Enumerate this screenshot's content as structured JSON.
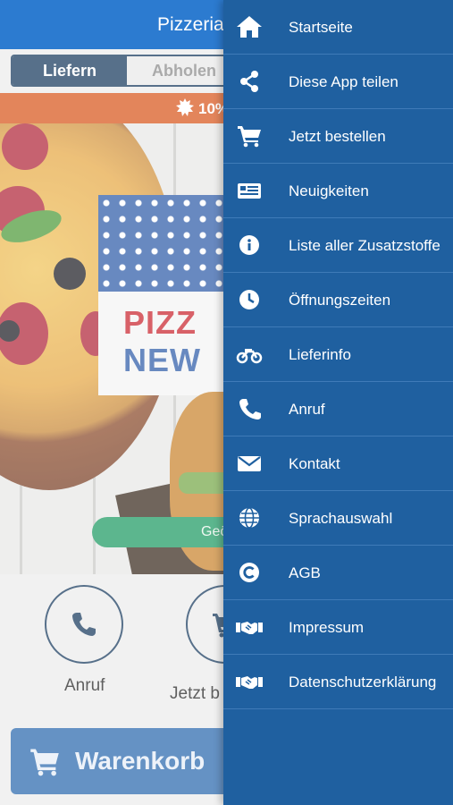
{
  "app": {
    "title": "Pizzeria",
    "order_mode": {
      "options": [
        "Liefern",
        "Abholen"
      ],
      "selected": "Liefern"
    },
    "promo_text": "10%",
    "hero": {
      "sign_line1": "PIZZ",
      "sign_line2": "NEW",
      "open_status": "Geö"
    },
    "quick_actions": [
      {
        "label": "Anruf",
        "icon": "phone-icon"
      },
      {
        "label": "Jetzt b",
        "icon": "cart-icon"
      }
    ],
    "cart_button": {
      "label": "Warenkorb",
      "icon": "cart-icon"
    }
  },
  "drawer": {
    "items": [
      {
        "label": "Startseite",
        "icon": "home-icon"
      },
      {
        "label": "Diese App teilen",
        "icon": "share-icon"
      },
      {
        "label": "Jetzt bestellen",
        "icon": "cart-icon"
      },
      {
        "label": "Neuigkeiten",
        "icon": "newspaper-icon"
      },
      {
        "label": "Liste aller Zusatzstoffe",
        "icon": "info-icon"
      },
      {
        "label": "Öffnungszeiten",
        "icon": "clock-icon"
      },
      {
        "label": "Lieferinfo",
        "icon": "motorcycle-icon"
      },
      {
        "label": "Anruf",
        "icon": "phone-icon"
      },
      {
        "label": "Kontakt",
        "icon": "envelope-icon"
      },
      {
        "label": "Sprachauswahl",
        "icon": "globe-icon"
      },
      {
        "label": "AGB",
        "icon": "copyright-icon"
      },
      {
        "label": "Impressum",
        "icon": "handshake-icon"
      },
      {
        "label": "Datenschutzerklärung",
        "icon": "handshake-icon"
      }
    ]
  },
  "colors": {
    "topbar": "#2c7bd0",
    "drawer": "#1f60a0",
    "toggle_active": "#173a5e",
    "promo": "#d9561d",
    "open_badge": "#1e9a63",
    "cart_bar": "#2a69ad"
  }
}
